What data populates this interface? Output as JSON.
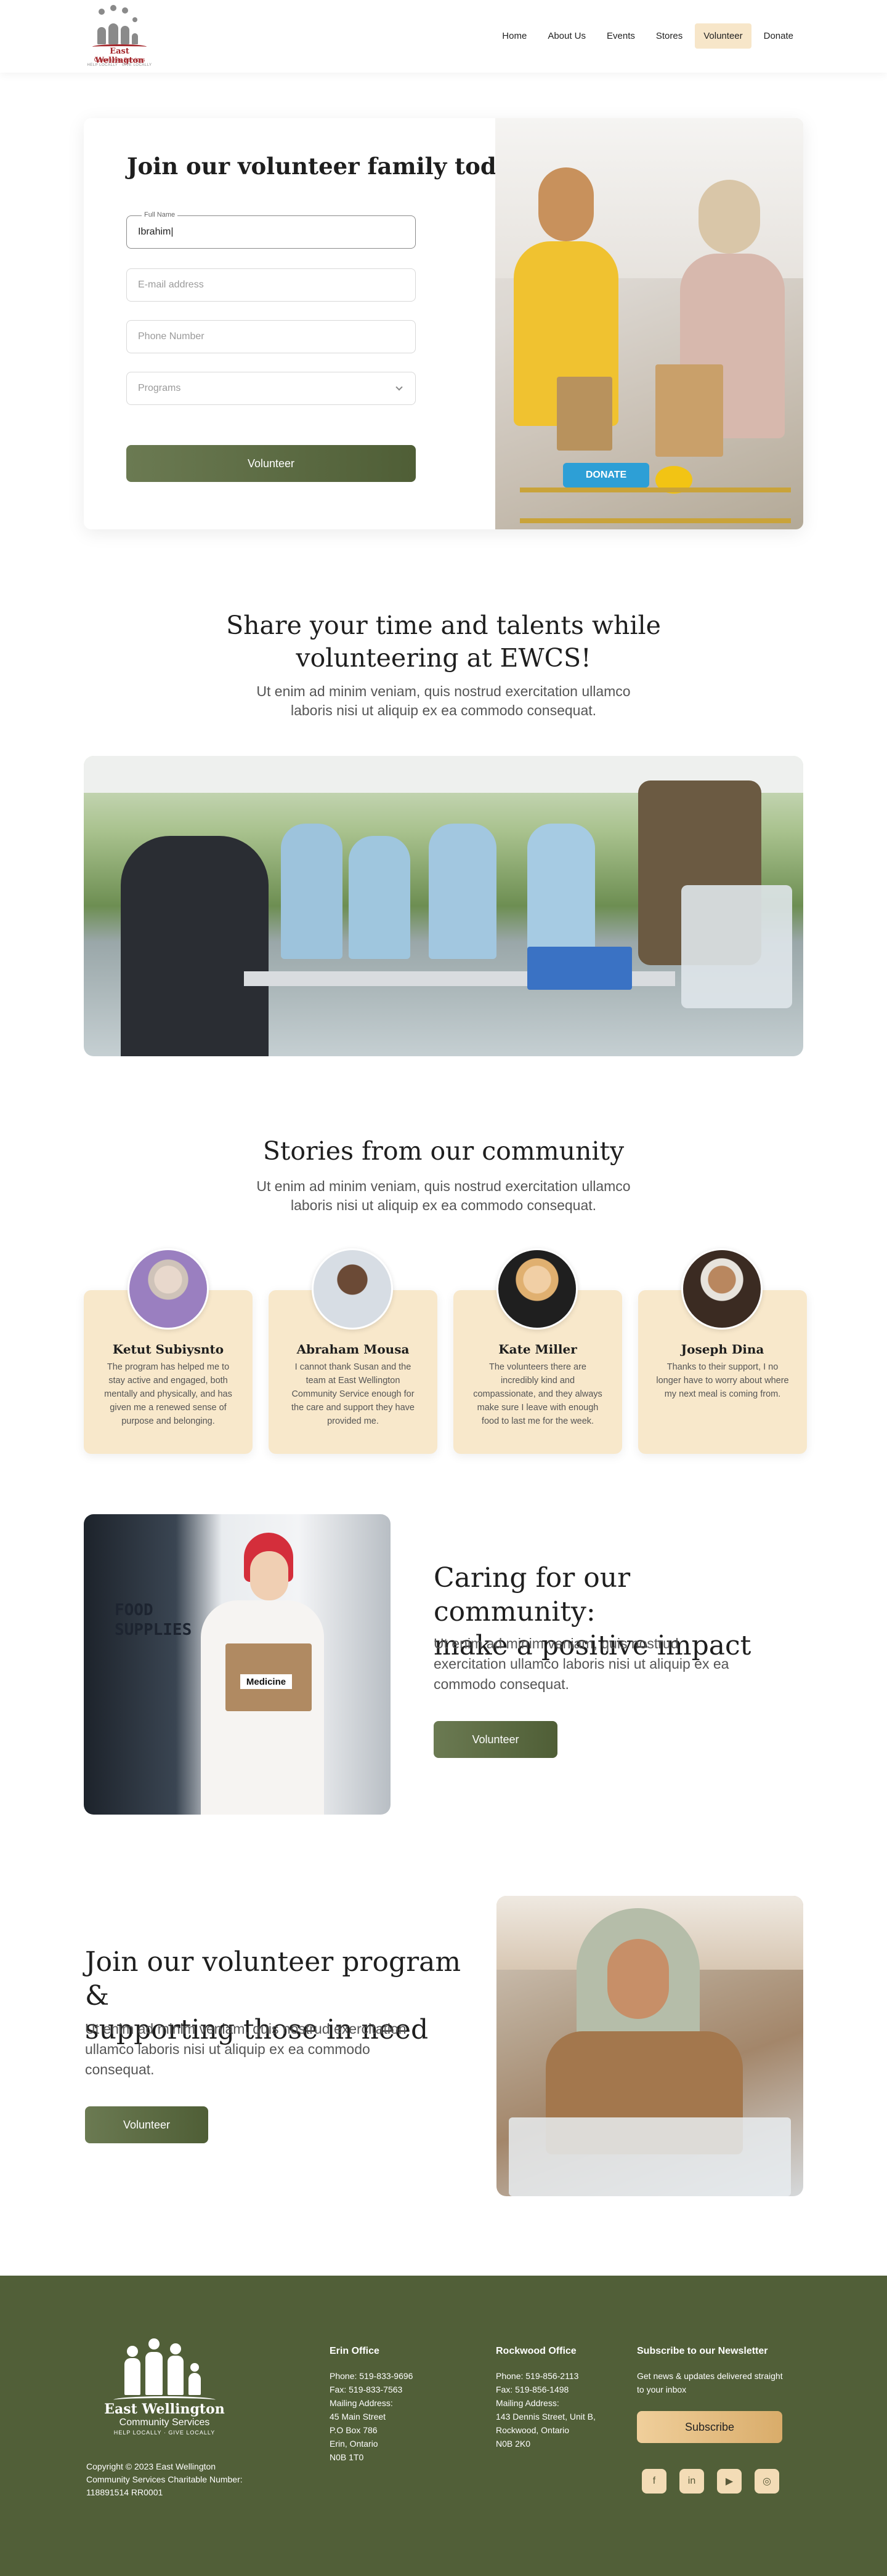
{
  "header": {
    "logo": {
      "line1": "East Wellington",
      "line2": "Community Services",
      "line3": "HELP LOCALLY · GIVE LOCALLY"
    },
    "nav": [
      {
        "label": "Home"
      },
      {
        "label": "About Us"
      },
      {
        "label": "Events"
      },
      {
        "label": "Stores"
      },
      {
        "label": "Volunteer",
        "active": true
      },
      {
        "label": "Donate"
      }
    ]
  },
  "form": {
    "title": "Join our volunteer family today!",
    "full_name_label": "Full Name",
    "full_name_value": "Ibrahim|",
    "email_placeholder": "E-mail address",
    "phone_placeholder": "Phone Number",
    "programs_placeholder": "Programs",
    "submit_label": "Volunteer"
  },
  "share": {
    "title_line1": "Share your time and talents while",
    "title_line2": "volunteering at EWCS!",
    "subtitle_line1": "Ut enim ad minim veniam, quis nostrud exercitation ullamco",
    "subtitle_line2": "laboris nisi ut aliquip ex ea commodo consequat."
  },
  "stories": {
    "title": "Stories from our community",
    "subtitle_line1": "Ut enim ad minim veniam, quis nostrud exercitation ullamco",
    "subtitle_line2": "laboris nisi ut aliquip ex ea commodo consequat.",
    "items": [
      {
        "name": "Ketut Subiysnto",
        "text": "The program has helped me to stay active and engaged, both mentally and physically, and has given me a renewed sense of purpose and belonging."
      },
      {
        "name": "Abraham Mousa",
        "text": "I cannot thank Susan and the team at East Wellington Community Service enough for the care and support they have provided me."
      },
      {
        "name": "Kate Miller",
        "text": "The volunteers there are incredibly kind and compassionate, and they always make sure I leave with enough food to last me for the week."
      },
      {
        "name": "Joseph Dina",
        "text": "Thanks to their support, I no longer have to worry about where my next meal is coming from."
      }
    ]
  },
  "caring": {
    "title_line1": "Caring for our community:",
    "title_line2": "make a positive impact",
    "subtitle": "Ut enim ad minim veniam, quis nostrud exercitation ullamco laboris nisi ut aliquip ex ea commodo consequat.",
    "button_label": "Volunteer",
    "photo_text_1": "FOOD",
    "photo_text_2": "SUPPLIES",
    "box_label": "Medicine"
  },
  "join": {
    "title_line1": "Join our volunteer program &",
    "title_line2": "supporting those in need",
    "subtitle": "Ut enim ad minim veniam, quis nostrud exercitation ullamco laboris nisi ut aliquip ex ea commodo consequat.",
    "button_label": "Volunteer"
  },
  "photo_a": {
    "sign_text": "DONATE"
  },
  "footer": {
    "logo": {
      "line1": "East Wellington",
      "line2": "Community Services",
      "line3": "HELP LOCALLY · GIVE LOCALLY"
    },
    "copyright": "Copyright © 2023 East Wellington Community Services Charitable Number: 118891514 RR0001",
    "erin": {
      "heading": "Erin Office",
      "lines": [
        "Phone: 519-833-9696",
        "Fax: 519-833-7563",
        "Mailing Address:",
        "45 Main Street",
        "P.O Box 786",
        "Erin, Ontario",
        "N0B 1T0"
      ]
    },
    "rockwood": {
      "heading": "Rockwood Office",
      "lines": [
        "Phone: 519-856-2113",
        "Fax: 519-856-1498",
        "Mailing Address:",
        "143 Dennis Street, Unit B,",
        "Rockwood, Ontario",
        "N0B 2K0"
      ]
    },
    "newsletter": {
      "heading": "Subscribe to our Newsletter",
      "text": "Get news & updates delivered straight to your inbox",
      "button_label": "Subscribe"
    },
    "social_icons": [
      "f",
      "in",
      "▶",
      "◎"
    ]
  }
}
